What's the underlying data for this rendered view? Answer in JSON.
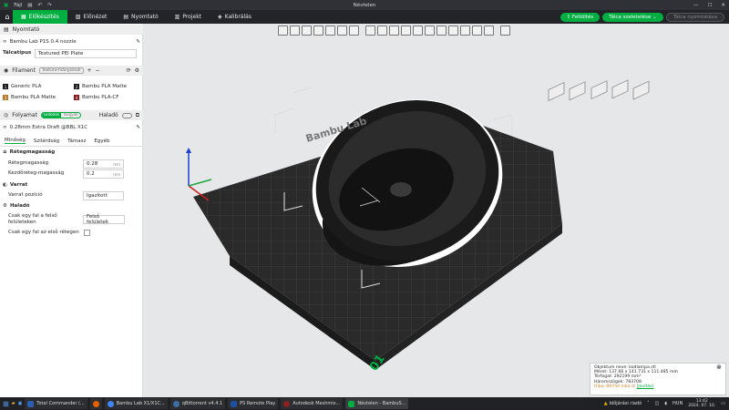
{
  "window": {
    "menu": "Fájl",
    "title": "Névtelen"
  },
  "tabs": [
    {
      "label": "Előkészítés"
    },
    {
      "label": "Előnézet"
    },
    {
      "label": "Nyomtató"
    },
    {
      "label": "Projekt"
    },
    {
      "label": "Kalibrálás"
    }
  ],
  "top_actions": {
    "upload": "Feltöltés",
    "slice_plate": "Tálca szeletelése",
    "print_plate": "Tálca nyomtatása"
  },
  "printer": {
    "section": "Nyomtató",
    "name": "Bambu Lab P1S 0.4 nozzle",
    "plate_label": "Tálcatípus",
    "plate_value": "Textured PEI Plate"
  },
  "filament": {
    "section": "Filament",
    "badge": "Textúra-hiányzónál",
    "items": [
      {
        "num": "1",
        "name": "Generic PLA",
        "color": "#1a1a1a"
      },
      {
        "num": "2",
        "name": "Bambu PLA Matte",
        "color": "#1a1a1a"
      },
      {
        "num": "3",
        "name": "Bambu PLA Matte",
        "color": "#b8792a"
      },
      {
        "num": "4",
        "name": "Bambu PLA-CF",
        "color": "#8b1a1a"
      }
    ]
  },
  "process": {
    "section": "Folyamat",
    "toggle_on": "Globális",
    "toggle_off": "Tárgyak",
    "advanced": "Haladó",
    "preset": "0.28mm Extra Draft @BBL X1C",
    "subtabs": [
      "Minőség",
      "Szilárdság",
      "Támasz",
      "Egyéb"
    ],
    "layer_height_title": "Rétegmagasság",
    "layer_height_label": "Rétegmagasság",
    "layer_height_value": "0.28",
    "unit": "mm",
    "first_layer_label": "Kezdőréteg-magasság",
    "first_layer_value": "0.2",
    "seam_title": "Varrat",
    "seam_label": "Varrat pozíció",
    "seam_value": "Igazított",
    "advanced_title": "Haladó",
    "wall_top_label": "Csak egy fal a felső felületeken",
    "wall_top_value": "Felső felületek",
    "wall_first_label": "Csak egy fal az első rétegen"
  },
  "viewport": {
    "plate_number": "01",
    "plate_brand": "Bambu Lab"
  },
  "object_info": {
    "name": "Objektum neve: kodlampa.stl",
    "size": "Méret: 137.66 x 141.731 x 111.485 mm",
    "volume": "Térfogat: 292199 mm³",
    "triangles": "Háromszögek: 783708",
    "error": "Hiba: 89744 hiba di",
    "link": "[Javítás]"
  },
  "taskbar": {
    "apps": [
      {
        "label": "Total Commander (...",
        "color": "#2b5fb4"
      },
      {
        "label": "",
        "color": "#e66000"
      },
      {
        "label": "Bambu Lab X1/X1C...",
        "color": "#4285f4"
      },
      {
        "label": "qBittorrent v4.4.1",
        "color": "#3a6ea5"
      },
      {
        "label": "PS Remote Play",
        "color": "#1f4fa0"
      },
      {
        "label": "Autodesk Meshmix...",
        "color": "#8a2020"
      },
      {
        "label": "Névtelen - BambuS...",
        "color": "#00ae42"
      }
    ],
    "weather": "Időjárási riadó",
    "lang": "HUN",
    "time": "13:42",
    "date": "2024. 07. 10."
  }
}
